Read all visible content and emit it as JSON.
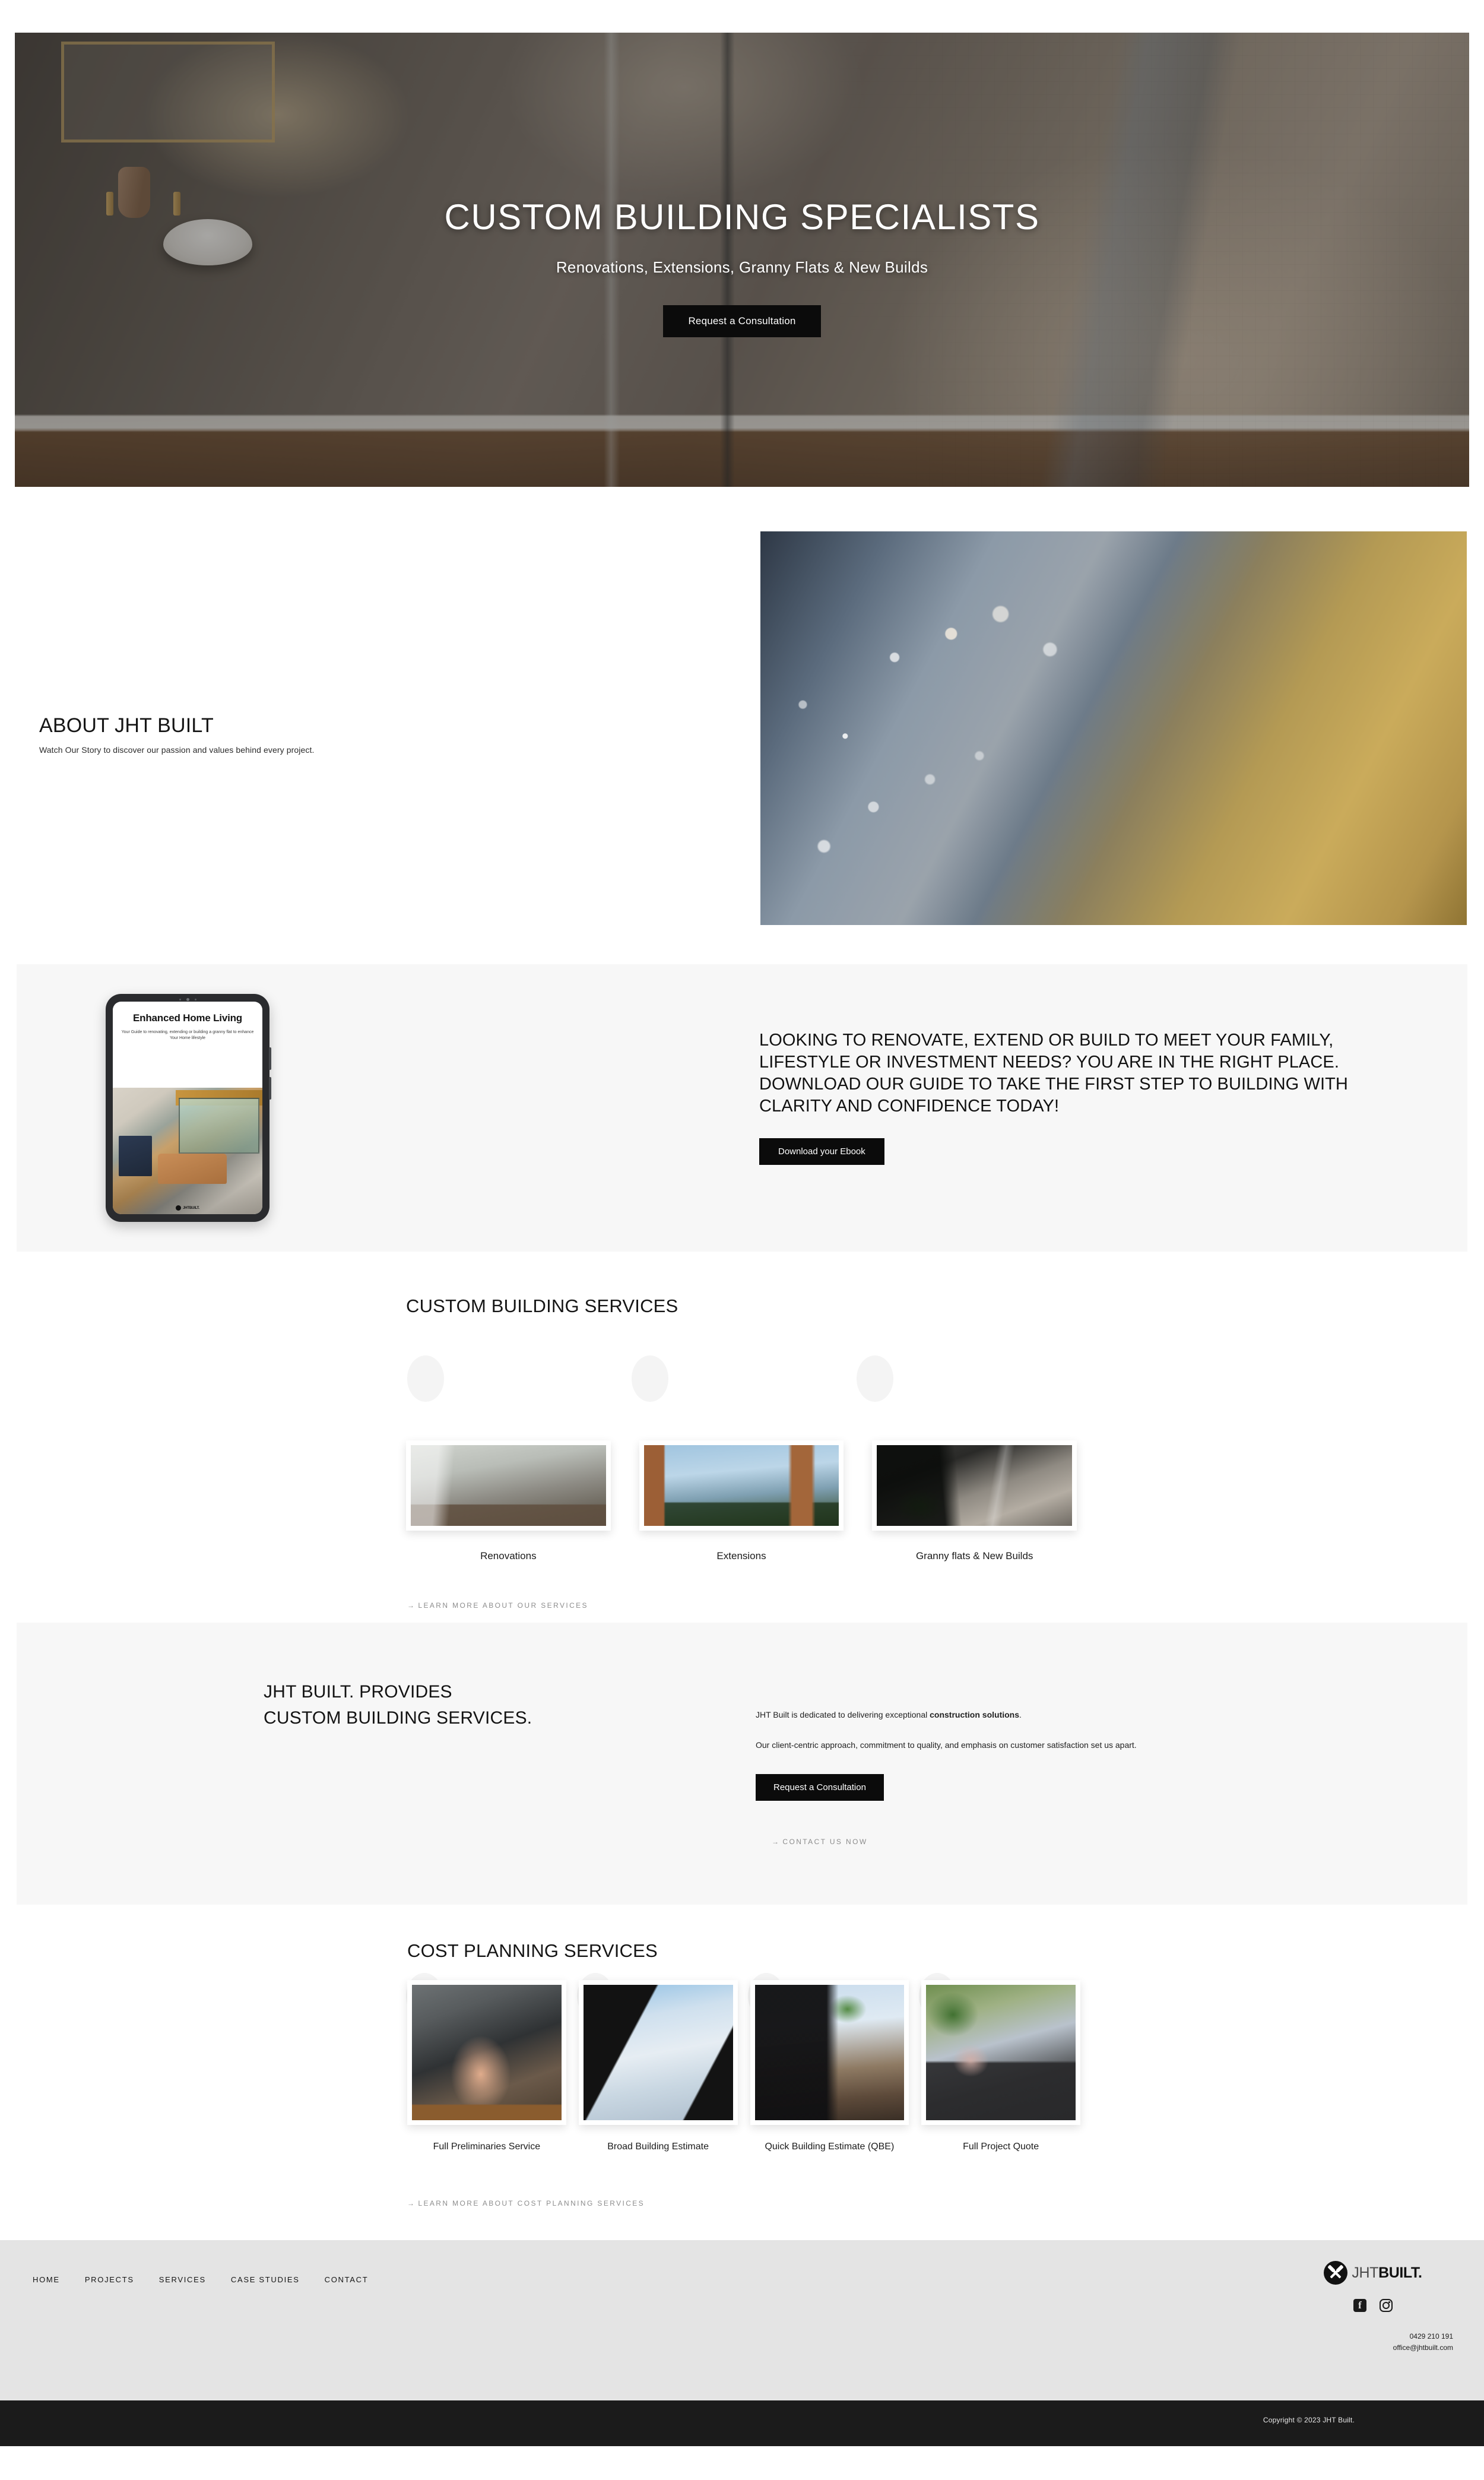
{
  "hero": {
    "title": "CUSTOM BUILDING SPECIALISTS",
    "subtitle": "Renovations, Extensions, Granny Flats & New Builds",
    "cta_label": "Request a Consultation"
  },
  "about": {
    "title": "ABOUT JHT BUILT",
    "text": "Watch Our Story to discover our passion and values behind every project."
  },
  "ebook": {
    "cover_title": "Enhanced Home Living",
    "cover_subtitle": "Your Guide to renovating, extending or building a granny flat to enhance Your Home lifestyle",
    "cover_logo_text": "JHTBUILT.",
    "headline": "LOOKING TO RENOVATE, EXTEND OR BUILD TO MEET YOUR FAMILY, LIFESTYLE OR INVESTMENT NEEDS? YOU ARE IN THE RIGHT PLACE. DOWNLOAD OUR GUIDE TO TAKE THE FIRST STEP TO BUILDING WITH CLARITY AND CONFIDENCE TODAY!",
    "cta_label": "Download your Ebook"
  },
  "services": {
    "title": "CUSTOM BUILDING SERVICES",
    "cards": [
      {
        "caption": "Renovations"
      },
      {
        "caption": "Extensions"
      },
      {
        "caption": "Granny flats & New Builds"
      }
    ],
    "link_label": "LEARN MORE ABOUT OUR SERVICES",
    "link_arrow": "→"
  },
  "provides": {
    "heading_line1": "JHT BUILT. PROVIDES",
    "heading_line2": "CUSTOM BUILDING SERVICES.",
    "paragraph1_pre": "JHT Built is dedicated to delivering exceptional ",
    "paragraph1_bold": "construction solutions",
    "paragraph1_post": ".",
    "paragraph2": "Our client-centric approach, commitment to quality, and emphasis on customer satisfaction set us apart.",
    "cta_label": "Request a Consultation",
    "link_label": "CONTACT US NOW",
    "link_arrow": "→"
  },
  "cost": {
    "title": "COST PLANNING SERVICES",
    "cards": [
      {
        "caption": "Full Preliminaries Service"
      },
      {
        "caption": "Broad Building Estimate"
      },
      {
        "caption": "Quick Building Estimate (QBE)"
      },
      {
        "caption": "Full Project Quote"
      }
    ],
    "link_label": "LEARN MORE ABOUT COST PLANNING SERVICES",
    "link_arrow": "→"
  },
  "footer": {
    "nav": [
      "HOME",
      "PROJECTS",
      "SERVICES",
      "CASE STUDIES",
      "CONTACT"
    ],
    "logo_light": "JHT",
    "logo_bold": "BUILT.",
    "phone": "0429 210 191",
    "email": "office@jhtbuilt.com",
    "copyright": "Copyright © 2023 JHT Built."
  },
  "colors": {
    "ink": "#111111",
    "band": "#f7f7f7",
    "footer_bg": "#e4e4e4",
    "copybar_bg": "#1b1b1b",
    "muted_link": "#8c8c8c"
  }
}
